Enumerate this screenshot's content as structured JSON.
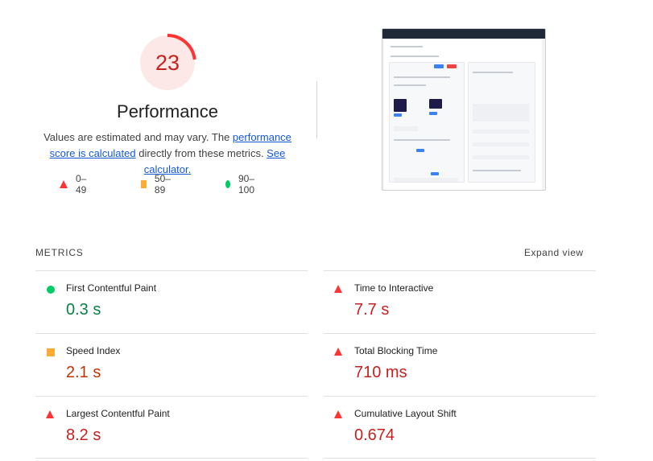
{
  "summary": {
    "score": "23",
    "score_fraction": 0.23,
    "title": "Performance",
    "desc_pre": "Values are estimated and may vary. The ",
    "desc_link1": "performance score is calculated",
    "desc_mid": " directly from these metrics. ",
    "desc_link2": "See calculator.",
    "colors": {
      "fail": "#ff3333",
      "average": "#ffaa33",
      "pass": "#00cc66"
    }
  },
  "legend": [
    {
      "icon": "triangle-red-icon",
      "label": "0–49"
    },
    {
      "icon": "square-orange-icon",
      "label": "50–89"
    },
    {
      "icon": "circle-green-icon",
      "label": "90–100"
    }
  ],
  "metrics_section": {
    "heading": "METRICS",
    "expand_label": "Expand view",
    "items": [
      {
        "title": "First Contentful Paint",
        "value": "0.3 s",
        "status": "pass"
      },
      {
        "title": "Time to Interactive",
        "value": "7.7 s",
        "status": "fail"
      },
      {
        "title": "Speed Index",
        "value": "2.1 s",
        "status": "average"
      },
      {
        "title": "Total Blocking Time",
        "value": "710 ms",
        "status": "fail"
      },
      {
        "title": "Largest Contentful Paint",
        "value": "8.2 s",
        "status": "fail"
      },
      {
        "title": "Cumulative Layout Shift",
        "value": "0.674",
        "status": "fail"
      }
    ]
  }
}
